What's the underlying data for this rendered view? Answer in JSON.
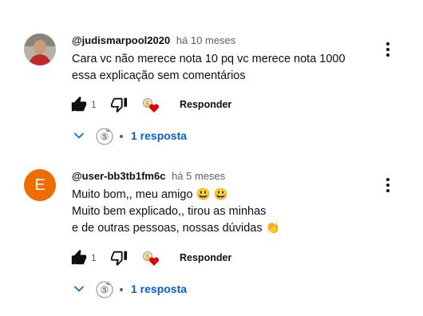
{
  "comments": [
    {
      "author": "@judismarpool2020",
      "time": "há 10 meses",
      "lines": [
        "Cara vc não merece nota 10 pq vc merece nota 1000",
        "essa explicação sem   comentários"
      ],
      "likes": "1",
      "reply_label": "Responder",
      "replies_label": "1 resposta",
      "avatar_type": "photo"
    },
    {
      "author": "@user-bb3tb1fm6c",
      "time": "há 5 meses",
      "lines": [
        "Muito bom,, meu amigo 😃 😃",
        "Muito bem explicado,, tirou as minhas",
        "e de outras pessoas, nossas dúvidas 👏"
      ],
      "likes": "1",
      "reply_label": "Responder",
      "replies_label": "1 resposta",
      "avatar_letter": "E",
      "avatar_color": "#ef6c00"
    }
  ],
  "icons": {
    "like": "thumb-up-icon",
    "dislike": "thumb-down-icon",
    "heart": "creator-heart-icon",
    "menu": "more-vert-icon",
    "expand": "chevron-down-icon"
  },
  "colors": {
    "link": "#065fd4",
    "heart": "#e00000",
    "avatar_e": "#ef6c00"
  }
}
